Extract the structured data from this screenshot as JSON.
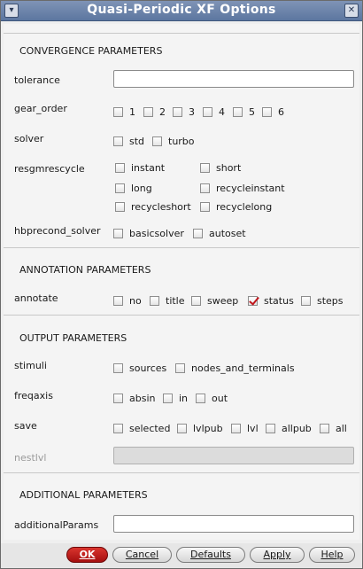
{
  "window": {
    "title": "Quasi-Periodic XF Options"
  },
  "sections": {
    "convergence": "CONVERGENCE PARAMETERS",
    "annotation": "ANNOTATION PARAMETERS",
    "output": "OUTPUT PARAMETERS",
    "additional": "ADDITIONAL PARAMETERS"
  },
  "fields": {
    "tolerance": {
      "label": "tolerance",
      "value": ""
    },
    "gear_order": {
      "label": "gear_order",
      "options": [
        "1",
        "2",
        "3",
        "4",
        "5",
        "6"
      ]
    },
    "solver": {
      "label": "solver",
      "options": [
        "std",
        "turbo"
      ]
    },
    "resgmrescycle": {
      "label": "resgmrescycle",
      "options": [
        "instant",
        "short",
        "long",
        "recycleinstant",
        "recycleshort",
        "recyclelong"
      ]
    },
    "hbprecond_solver": {
      "label": "hbprecond_solver",
      "options": [
        "basicsolver",
        "autoset"
      ]
    },
    "annotate": {
      "label": "annotate",
      "options": [
        "no",
        "title",
        "sweep",
        "status",
        "steps"
      ],
      "checked": "status"
    },
    "stimuli": {
      "label": "stimuli",
      "options": [
        "sources",
        "nodes_and_terminals"
      ]
    },
    "freqaxis": {
      "label": "freqaxis",
      "options": [
        "absin",
        "in",
        "out"
      ]
    },
    "save": {
      "label": "save",
      "options": [
        "selected",
        "lvlpub",
        "lvl",
        "allpub",
        "all"
      ]
    },
    "nestlvl": {
      "label": "nestlvl",
      "value": ""
    },
    "additionalParams": {
      "label": "additionalParams",
      "value": ""
    }
  },
  "buttons": {
    "ok": "OK",
    "cancel": "Cancel",
    "defaults": "Defaults",
    "apply": "Apply",
    "help": "Help"
  },
  "colors": {
    "titlebar": "#6a82aa",
    "ok_button": "#c21d1d",
    "check_mark": "#c0161c"
  }
}
